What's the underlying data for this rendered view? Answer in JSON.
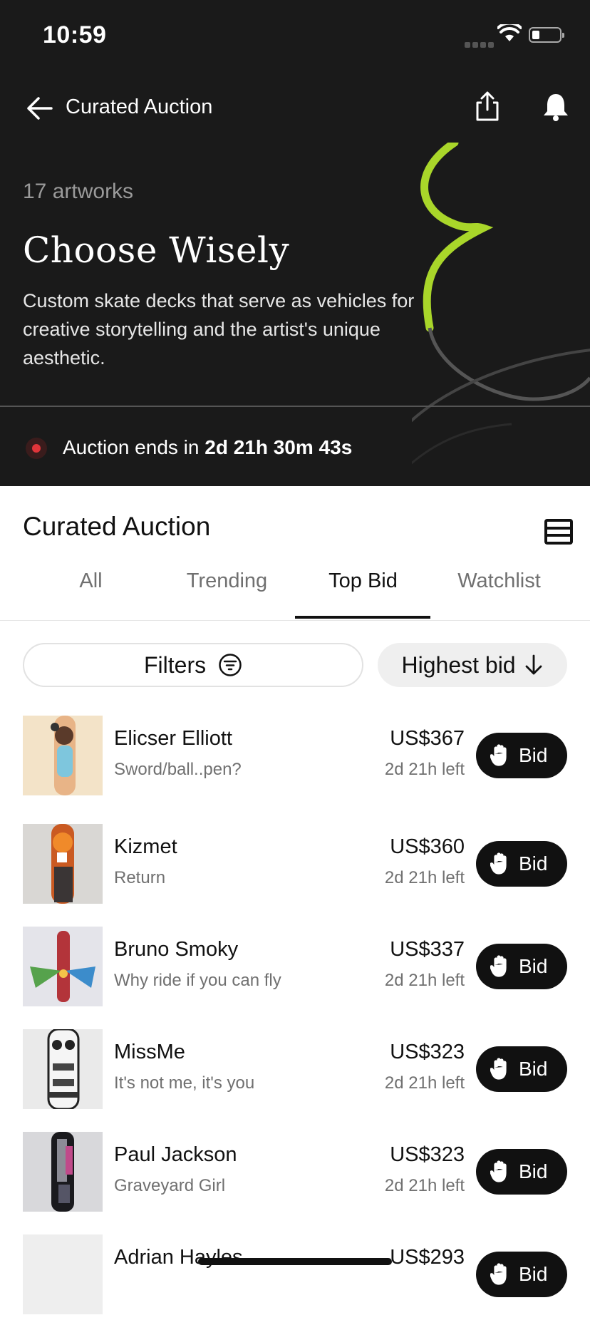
{
  "status_bar": {
    "time": "10:59"
  },
  "nav": {
    "title": "Curated Auction"
  },
  "hero": {
    "count": "17 artworks",
    "headline": "Choose Wisely",
    "description": "Custom skate decks that serve as vehicles for creative storytelling and the artist's unique aesthetic."
  },
  "timer": {
    "prefix": "Auction ends in ",
    "remaining": "2d 21h 30m 43s"
  },
  "section": {
    "title": "Curated Auction"
  },
  "tabs": [
    "All",
    "Trending",
    "Top Bid",
    "Watchlist"
  ],
  "active_tab": "Top Bid",
  "filters": {
    "filters_label": "Filters",
    "sort_label": "Highest bid"
  },
  "bid_label": "Bid",
  "lots": [
    {
      "artist": "Elicser Elliott",
      "title": "Sword/ball..pen?",
      "price": "US$367",
      "time_left": "2d 21h left"
    },
    {
      "artist": "Kizmet",
      "title": "Return",
      "price": "US$360",
      "time_left": "2d 21h left"
    },
    {
      "artist": "Bruno Smoky",
      "title": "Why ride if you can fly",
      "price": "US$337",
      "time_left": "2d 21h left"
    },
    {
      "artist": "MissMe",
      "title": "It's not me, it's you",
      "price": "US$323",
      "time_left": "2d 21h left"
    },
    {
      "artist": "Paul Jackson",
      "title": "Graveyard Girl",
      "price": "US$323",
      "time_left": "2d 21h left"
    },
    {
      "artist": "Adrian Hayles",
      "title": "",
      "price": "US$293",
      "time_left": ""
    }
  ],
  "colors": {
    "dark_bg": "#1a1a1a",
    "accent_green": "#a9d62a",
    "live_dot": "#e0353a"
  }
}
